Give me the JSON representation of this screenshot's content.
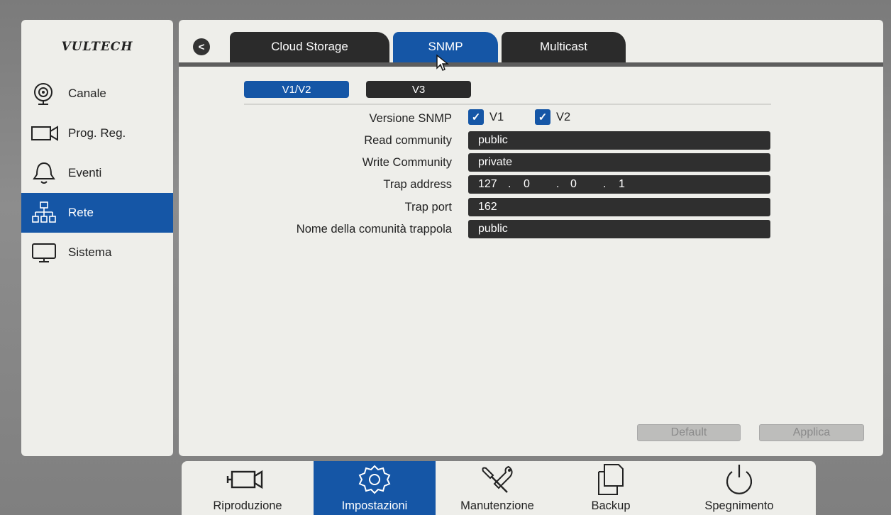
{
  "brand": {
    "logo_text": "VULTECH"
  },
  "sidebar": {
    "items": [
      {
        "label": "Canale",
        "icon": "camera-lens-icon"
      },
      {
        "label": "Prog. Reg.",
        "icon": "video-camera-icon"
      },
      {
        "label": "Eventi",
        "icon": "bell-icon"
      },
      {
        "label": "Rete",
        "icon": "network-icon",
        "active": true
      },
      {
        "label": "Sistema",
        "icon": "monitor-icon"
      }
    ]
  },
  "tabs": {
    "back": "<",
    "items": [
      {
        "label": "Cloud Storage"
      },
      {
        "label": "SNMP",
        "active": true
      },
      {
        "label": "Multicast"
      }
    ]
  },
  "subtabs": {
    "items": [
      {
        "label": "V1/V2",
        "active": true
      },
      {
        "label": "V3"
      }
    ]
  },
  "form": {
    "version": {
      "label": "Versione SNMP",
      "v1_label": "V1",
      "v1_checked": true,
      "v2_label": "V2",
      "v2_checked": true
    },
    "read_community": {
      "label": "Read community",
      "value": "public"
    },
    "write_community": {
      "label": "Write Community",
      "value": "private"
    },
    "trap_address": {
      "label": "Trap address",
      "octets": [
        "127",
        "0",
        "0",
        "1"
      ],
      "sep": "."
    },
    "trap_port": {
      "label": "Trap port",
      "value": "162"
    },
    "trap_community": {
      "label": "Nome della comunità trappola",
      "value": "public"
    }
  },
  "actions": {
    "default_label": "Default",
    "apply_label": "Applica"
  },
  "dock": {
    "items": [
      {
        "label": "Riproduzione",
        "icon": "video-camera-icon"
      },
      {
        "label": "Impostazioni",
        "icon": "gear-icon",
        "active": true
      },
      {
        "label": "Manutenzione",
        "icon": "tools-icon"
      },
      {
        "label": "Backup",
        "icon": "copy-documents-icon"
      },
      {
        "label": "Spegnimento",
        "icon": "power-icon"
      }
    ]
  },
  "colors": {
    "accent": "#1556a6",
    "field_bg": "#2f2f2f",
    "panel_bg": "#eeeeea",
    "tab_bg": "#2b2b2b"
  }
}
